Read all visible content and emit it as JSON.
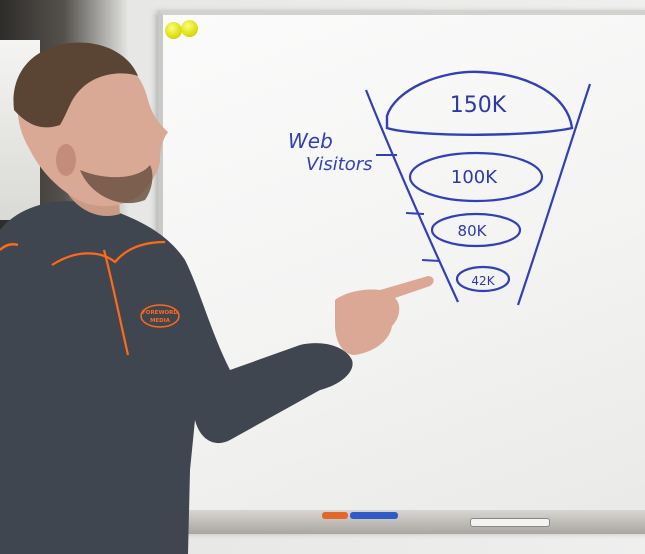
{
  "whiteboard": {
    "label_line1": "Web",
    "label_line2": "Visitors",
    "funnel_stages": [
      "150K",
      "100K",
      "80K",
      "42K"
    ]
  },
  "shirt": {
    "logo_line1": "FOREWORD",
    "logo_line2": "MEDIA"
  },
  "colors": {
    "ink": "#3340b5",
    "shirt": "#3f4650",
    "accent": "#ff6a1a",
    "board": "#f4f4f3"
  }
}
